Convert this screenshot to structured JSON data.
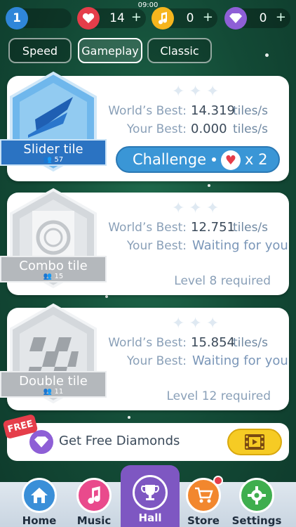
{
  "status": {
    "time": "09:00"
  },
  "resources": {
    "level": "1",
    "hearts": "14",
    "coins": "0",
    "diamonds": "0",
    "plus": "+"
  },
  "tabs": [
    {
      "label": "Speed"
    },
    {
      "label": "Gameplay"
    },
    {
      "label": "Classic"
    }
  ],
  "labels": {
    "worlds_best": "World’s Best:",
    "your_best": "Your Best:",
    "unit": "tiles/s"
  },
  "cards": [
    {
      "name": "Slider tile",
      "count": "57",
      "worlds_best": "14.319",
      "your_best": "0.000"
    },
    {
      "name": "Combo tile",
      "count": "15",
      "worlds_best": "12.751",
      "your_best": "Waiting for you",
      "requirement": "Level 8 required"
    },
    {
      "name": "Double tile",
      "count": "11",
      "worlds_best": "15.854",
      "your_best": "Waiting for you",
      "requirement": "Level 12 required"
    }
  ],
  "challenge": {
    "label": "Challenge",
    "cost": "x 2"
  },
  "free_diamonds": {
    "badge": "FREE",
    "label": "Get Free Diamonds"
  },
  "nav": [
    {
      "label": "Home",
      "icon": "home-icon",
      "color": "#3a8fd8"
    },
    {
      "label": "Music",
      "icon": "music-note-icon",
      "color": "#e94a8c"
    },
    {
      "label": "Hall",
      "icon": "trophy-icon",
      "color": "#7e57c2"
    },
    {
      "label": "Store",
      "icon": "cart-icon",
      "color": "#f2872e"
    },
    {
      "label": "Settings",
      "icon": "gear-icon",
      "color": "#3fae4e"
    }
  ],
  "colors": {
    "accent": "#3a96d6",
    "heart": "#e53d4a",
    "coin": "#f6b51d",
    "diamond": "#8e5fd6"
  }
}
